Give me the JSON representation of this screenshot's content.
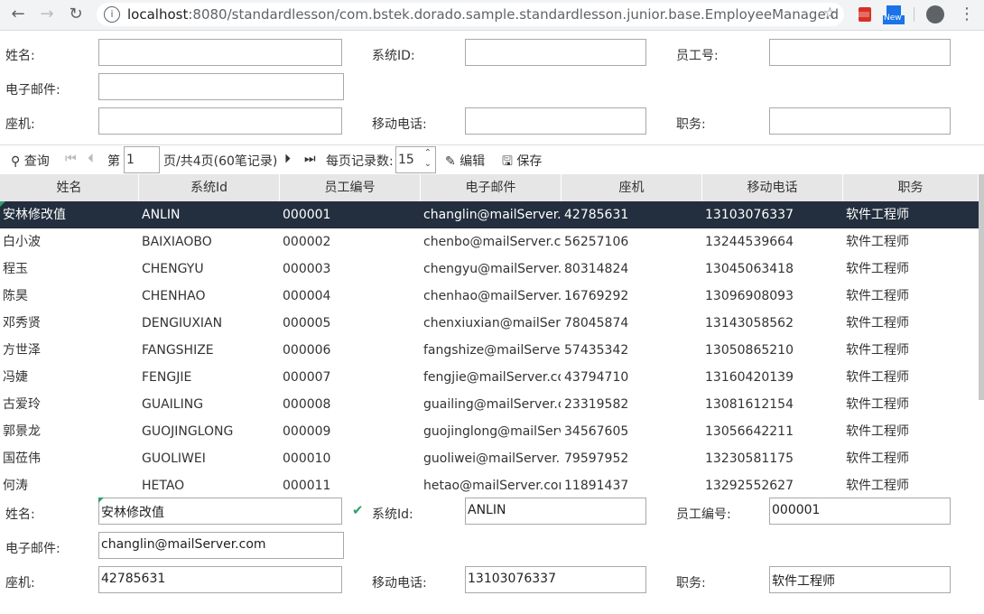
{
  "browser": {
    "url_host": "localhost",
    "url_path": ":8080/standardlesson/com.bstek.dorado.sample.standardlesson.junior.base.EmployeeManage.d",
    "ext_label": "New"
  },
  "filter": {
    "name_label": "姓名:",
    "sysid_label": "系统ID:",
    "empno_label": "员工号:",
    "email_label": "电子邮件:",
    "phone_label": "座机:",
    "mobile_label": "移动电话:",
    "title_label": "职务:",
    "name_value": "",
    "sysid_value": "",
    "empno_value": "",
    "email_value": "",
    "phone_value": "",
    "mobile_value": "",
    "title_value": ""
  },
  "toolbar": {
    "query": "查询",
    "page_prefix": "第",
    "page_value": "1",
    "page_suffix": "页/共4页(60笔记录)",
    "page_size_label": "每页记录数:",
    "page_size_value": "15",
    "edit": "编辑",
    "save": "保存"
  },
  "grid": {
    "columns": [
      "姓名",
      "系统Id",
      "员工编号",
      "电子邮件",
      "座机",
      "移动电话",
      "职务"
    ],
    "rows": [
      [
        "安林修改值",
        "ANLIN",
        "000001",
        "changlin@mailServer.com",
        "42785631",
        "13103076337",
        "软件工程师"
      ],
      [
        "白小波",
        "BAIXIAOBO",
        "000002",
        "chenbo@mailServer.com",
        "56257106",
        "13244539664",
        "软件工程师"
      ],
      [
        "程玉",
        "CHENGYU",
        "000003",
        "chengyu@mailServer.com",
        "80314824",
        "13045063418",
        "软件工程师"
      ],
      [
        "陈昊",
        "CHENHAO",
        "000004",
        "chenhao@mailServer.com",
        "16769292",
        "13096908093",
        "软件工程师"
      ],
      [
        "邓秀贤",
        "DENGIUXIAN",
        "000005",
        "chenxiuxian@mailServer.com",
        "78045874",
        "13143058562",
        "软件工程师"
      ],
      [
        "方世泽",
        "FANGSHIZE",
        "000006",
        "fangshize@mailServer.com",
        "57435342",
        "13050865210",
        "软件工程师"
      ],
      [
        "冯婕",
        "FENGJIE",
        "000007",
        "fengjie@mailServer.com",
        "43794710",
        "13160420139",
        "软件工程师"
      ],
      [
        "古爱玲",
        "GUAILING",
        "000008",
        "guailing@mailServer.com",
        "23319582",
        "13081612154",
        "软件工程师"
      ],
      [
        "郭景龙",
        "GUOJINGLONG",
        "000009",
        "guojinglong@mailServer.com",
        "34567605",
        "13056642211",
        "软件工程师"
      ],
      [
        "国莅伟",
        "GUOLIWEI",
        "000010",
        "guoliwei@mailServer.com",
        "79597952",
        "13230581175",
        "软件工程师"
      ],
      [
        "何涛",
        "HETAO",
        "000011",
        "hetao@mailServer.com",
        "11891437",
        "13292552627",
        "软件工程师"
      ]
    ]
  },
  "detail": {
    "name_label": "姓名:",
    "sysid_label": "系统Id:",
    "empno_label": "员工编号:",
    "email_label": "电子邮件:",
    "phone_label": "座机:",
    "mobile_label": "移动电话:",
    "title_label": "职务:",
    "name_value": "安林修改值",
    "sysid_value": "ANLIN",
    "empno_value": "000001",
    "email_value": "changlin@mailServer.com",
    "phone_value": "42785631",
    "mobile_value": "13103076337",
    "title_value": "软件工程师"
  },
  "colors": {
    "selected_row": "#232f3e",
    "dirty_marker": "#2fa06c"
  }
}
